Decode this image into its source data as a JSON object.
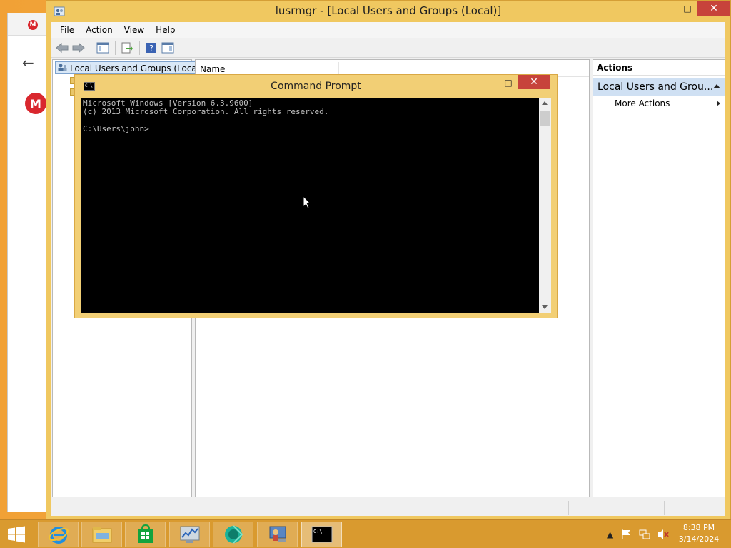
{
  "mmc": {
    "title": "lusrmgr - [Local Users and Groups (Local)]",
    "menu": [
      "File",
      "Action",
      "View",
      "Help"
    ],
    "tree_root": "Local Users and Groups (Local)",
    "list_column": "Name",
    "actions_header": "Actions",
    "actions_group": "Local Users and Grou...",
    "more_actions": "More Actions"
  },
  "cmd": {
    "title": "Command Prompt",
    "icon_text": "C:\\_",
    "console_text": "Microsoft Windows [Version 6.3.9600]\n(c) 2013 Microsoft Corporation. All rights reserved.\n\nC:\\Users\\john>"
  },
  "caption": {
    "minimize": "–",
    "maximize": "□",
    "close": "✕"
  },
  "browser": {
    "mega_letter": "M",
    "back": "←"
  },
  "taskbar": {
    "apps": [
      "internet-explorer-icon",
      "file-explorer-icon",
      "store-icon",
      "performance-monitor-icon",
      "app-icon",
      "computer-management-icon",
      "command-prompt-icon"
    ],
    "cmd_icon_text": "C:\\_",
    "tray_up": "▲"
  },
  "clock": {
    "time": "8:38 PM",
    "date": "3/14/2024"
  },
  "colors": {
    "accent": "#f1a136",
    "close": "#c7433b",
    "selection": "#cfe0f3"
  }
}
